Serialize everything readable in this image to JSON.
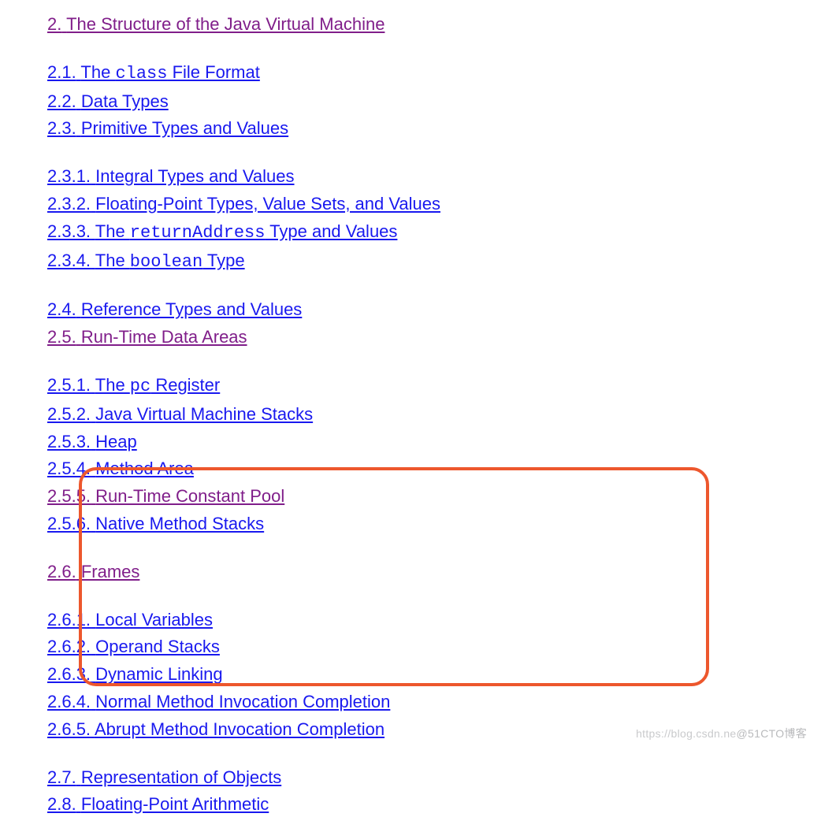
{
  "title": {
    "num": "2.",
    "text": "The Structure of the Java Virtual Machine"
  },
  "s21": {
    "num": "2.1.",
    "pre": "The ",
    "code": "class",
    "post": " File Format"
  },
  "s22": {
    "num": "2.2.",
    "text": "Data Types"
  },
  "s23": {
    "num": "2.3.",
    "text": "Primitive Types and Values"
  },
  "s231": {
    "num": "2.3.1.",
    "text": "Integral Types and Values"
  },
  "s232": {
    "num": "2.3.2.",
    "text": "Floating-Point Types, Value Sets, and Values"
  },
  "s233": {
    "num": "2.3.3.",
    "pre": "The ",
    "code": "returnAddress",
    "post": " Type and Values"
  },
  "s234": {
    "num": "2.3.4.",
    "pre": "The ",
    "code": "boolean",
    "post": " Type"
  },
  "s24": {
    "num": "2.4.",
    "text": "Reference Types and Values"
  },
  "s25": {
    "num": "2.5.",
    "text": "Run-Time Data Areas"
  },
  "s251": {
    "num": "2.5.1.",
    "pre": "The ",
    "code": "pc",
    "post": " Register"
  },
  "s252": {
    "num": "2.5.2.",
    "text": "Java Virtual Machine Stacks"
  },
  "s253": {
    "num": "2.5.3.",
    "text": "Heap"
  },
  "s254": {
    "num": "2.5.4.",
    "text": "Method Area"
  },
  "s255": {
    "num": "2.5.5.",
    "text": "Run-Time Constant Pool"
  },
  "s256": {
    "num": "2.5.6.",
    "text": "Native Method Stacks"
  },
  "s26": {
    "num": "2.6.",
    "text": "Frames"
  },
  "s261": {
    "num": "2.6.1.",
    "text": "Local Variables"
  },
  "s262": {
    "num": "2.6.2.",
    "text": "Operand Stacks"
  },
  "s263": {
    "num": "2.6.3.",
    "text": "Dynamic Linking"
  },
  "s264": {
    "num": "2.6.4.",
    "text": "Normal Method Invocation Completion"
  },
  "s265": {
    "num": "2.6.5.",
    "text": "Abrupt Method Invocation Completion"
  },
  "s27": {
    "num": "2.7.",
    "text": "Representation of Objects"
  },
  "s28": {
    "num": "2.8.",
    "text": "Floating-Point Arithmetic"
  },
  "watermark": {
    "left": "https://blog.csdn.ne",
    "right": "@51CTO博客"
  }
}
